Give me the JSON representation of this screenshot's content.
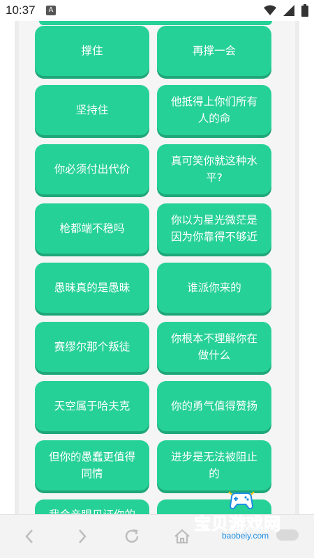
{
  "status_bar": {
    "time": "10:37",
    "notification_icon": "font-icon",
    "icons": [
      "wifi-icon",
      "signal-icon",
      "battery-icon"
    ]
  },
  "buttons": [
    {
      "label": "撑住"
    },
    {
      "label": "再撑一会"
    },
    {
      "label": "坚持住"
    },
    {
      "label": "他抵得上你们所有人的命"
    },
    {
      "label": "你必须付出代价"
    },
    {
      "label": "真可笑你就这种水平?"
    },
    {
      "label": "枪都端不稳吗"
    },
    {
      "label": "你以为星光微茫是因为你靠得不够近"
    },
    {
      "label": "愚昧真的是愚昧"
    },
    {
      "label": "谁派你来的"
    },
    {
      "label": "赛缪尔那个叛徒"
    },
    {
      "label": "你根本不理解你在做什么"
    },
    {
      "label": "天空属于哈夫克"
    },
    {
      "label": "你的勇气值得赞扬"
    },
    {
      "label": "但你的愚蠢更值得同情"
    },
    {
      "label": "进步是无法被阻止的"
    },
    {
      "label": "我会亲眼见证你的"
    },
    {
      "label": ""
    }
  ],
  "nav_bar": {
    "icons": [
      "back-icon",
      "forward-icon",
      "refresh-icon",
      "home-icon"
    ]
  },
  "watermark": {
    "text": "宝贝游戏网",
    "url": "baobeiy.com",
    "icon": "gamepad-icon"
  },
  "colors": {
    "button": "#26d197",
    "button_shadow": "#1fa77a",
    "watermark": "#1d8fe6"
  }
}
